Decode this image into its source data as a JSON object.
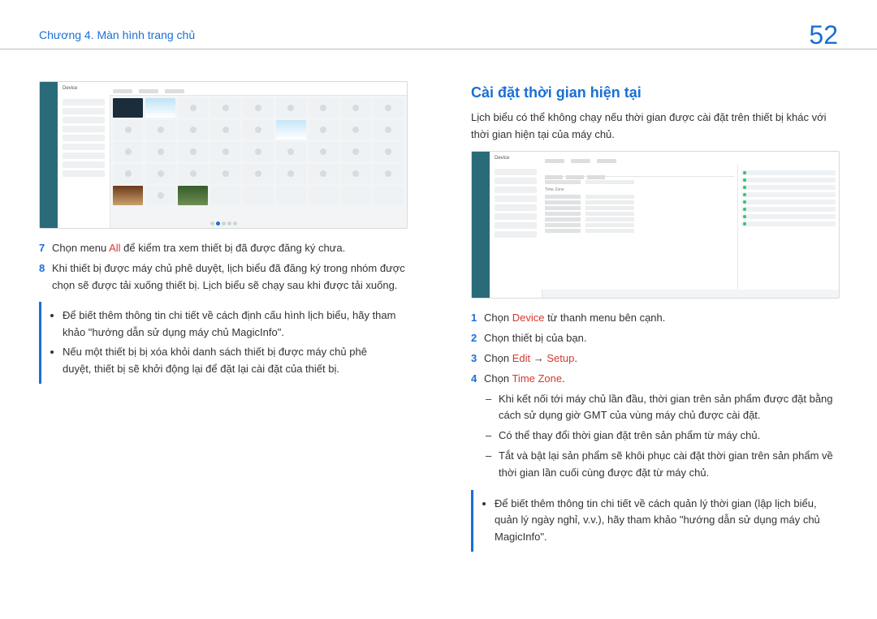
{
  "header": {
    "chapter": "Chương 4. Màn hình trang chủ",
    "page_number": "52"
  },
  "left": {
    "shot": {
      "panel_title": "Device"
    },
    "steps": [
      {
        "n": "7",
        "pre": "Chọn menu ",
        "kw": "All",
        "post": " để kiểm tra xem thiết bị đã được đăng ký chưa."
      },
      {
        "n": "8",
        "pre": "",
        "kw": "",
        "post": "Khi thiết bị được máy chủ phê duyệt, lịch biểu đã đăng ký trong nhóm được chọn sẽ được tải xuống thiết bị. Lịch biểu sẽ chạy sau khi được tải xuống."
      }
    ],
    "note_items": [
      "Để biết thêm thông tin chi tiết về cách định cấu hình lịch biểu, hãy tham khảo \"hướng dẫn sử dụng máy chủ MagicInfo\".",
      "Nếu một thiết bị bị xóa khỏi danh sách thiết bị được máy chủ phê duyệt, thiết bị sẽ khởi động lại để đặt lại cài đặt của thiết bị."
    ]
  },
  "right": {
    "title": "Cài đặt thời gian hiện tại",
    "intro": "Lịch biểu có thể không chạy nếu thời gian được cài đặt trên thiết bị khác với thời gian hiện tại của máy chủ.",
    "shot": {
      "panel_title": "Device",
      "section_label": "Time Zone"
    },
    "steps": [
      {
        "n": "1",
        "pre": "Chọn ",
        "kw": "Device",
        "post": " từ thanh menu bên cạnh."
      },
      {
        "n": "2",
        "pre": "Chọn thiết bị của bạn.",
        "kw": "",
        "post": ""
      },
      {
        "n": "3",
        "pre": "Chọn ",
        "kw": "Edit",
        "mid": " → ",
        "kw2": "Setup",
        "post": "."
      },
      {
        "n": "4",
        "pre": "Chọn ",
        "kw": "Time Zone",
        "post": "."
      }
    ],
    "dashes": [
      "Khi kết nối tới máy chủ lần đầu, thời gian trên sản phẩm được đặt bằng cách sử dụng giờ GMT của vùng máy chủ được cài đặt.",
      "Có thể thay đổi thời gian đặt trên sản phẩm từ máy chủ.",
      "Tắt và bật lại sản phẩm sẽ khôi phục cài đặt thời gian trên sản phẩm về thời gian lần cuối cùng được đặt từ máy chủ."
    ],
    "note_items": [
      "Để biết thêm thông tin chi tiết về cách quản lý thời gian (lập lịch biểu, quản lý ngày nghỉ, v.v.), hãy tham khảo \"hướng dẫn sử dụng máy chủ MagicInfo\"."
    ]
  }
}
